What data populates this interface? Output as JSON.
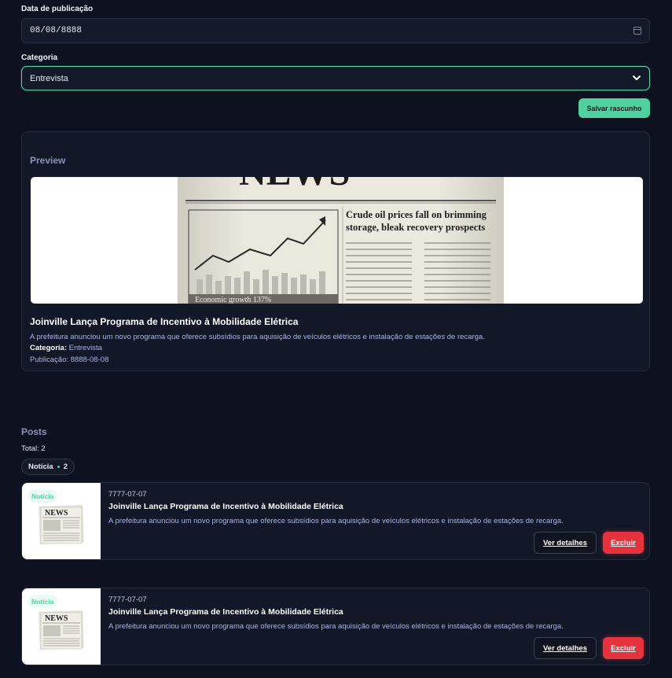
{
  "form": {
    "date_label": "Data de publicação",
    "date_value": "08/08/8888",
    "category_label": "Categoria",
    "category_value": "Entrevista",
    "save_label": "Salvar rascunho"
  },
  "preview": {
    "section_title": "Preview",
    "image_text": {
      "masthead": "NEWS",
      "headline_line1": "Crude oil prices fall on brimming",
      "headline_line2": "storage, bleak recovery prospects",
      "chart_caption": "Economic growth 137%"
    },
    "headline": "Joinville Lança Programa de Incentivo à Mobilidade Elétrica",
    "description": "A prefeitura anunciou um novo programa que oferece subsídios para aquisição de veículos elétricos e instalação de estações de recarga.",
    "category_key": "Categoria:",
    "category_value": "Entrevista",
    "publication": "Publicação: 8888-08-08"
  },
  "posts": {
    "section_title": "Posts",
    "total": "Total: 2",
    "chip": {
      "label": "Notícia",
      "count": "2"
    },
    "items": [
      {
        "badge": "Notícia",
        "thumb_text": "NEWS",
        "date": "7777-07-07",
        "title": "Joinville Lança Programa de Incentivo à Mobilidade Elétrica",
        "description": "A prefeitura anunciou um novo programa que oferece subsídios para aquisição de veículos elétricos e instalação de estações de recarga.",
        "details_label": "Ver detalhes",
        "delete_label": "Excluir"
      },
      {
        "badge": "Notícia",
        "thumb_text": "NEWS",
        "date": "7777-07-07",
        "title": "Joinville Lança Programa de Incentivo à Mobilidade Elétrica",
        "description": "A prefeitura anunciou um novo programa que oferece subsídios para aquisição de veículos elétricos e instalação de estações de recarga.",
        "details_label": "Ver detalhes",
        "delete_label": "Excluir"
      }
    ]
  },
  "colors": {
    "background": "#0e1220",
    "accent": "#4fd1a0",
    "danger": "#e5323d",
    "section_title": "#8a93b8"
  },
  "icons": [
    "calendar-icon",
    "chevron-down-icon"
  ]
}
